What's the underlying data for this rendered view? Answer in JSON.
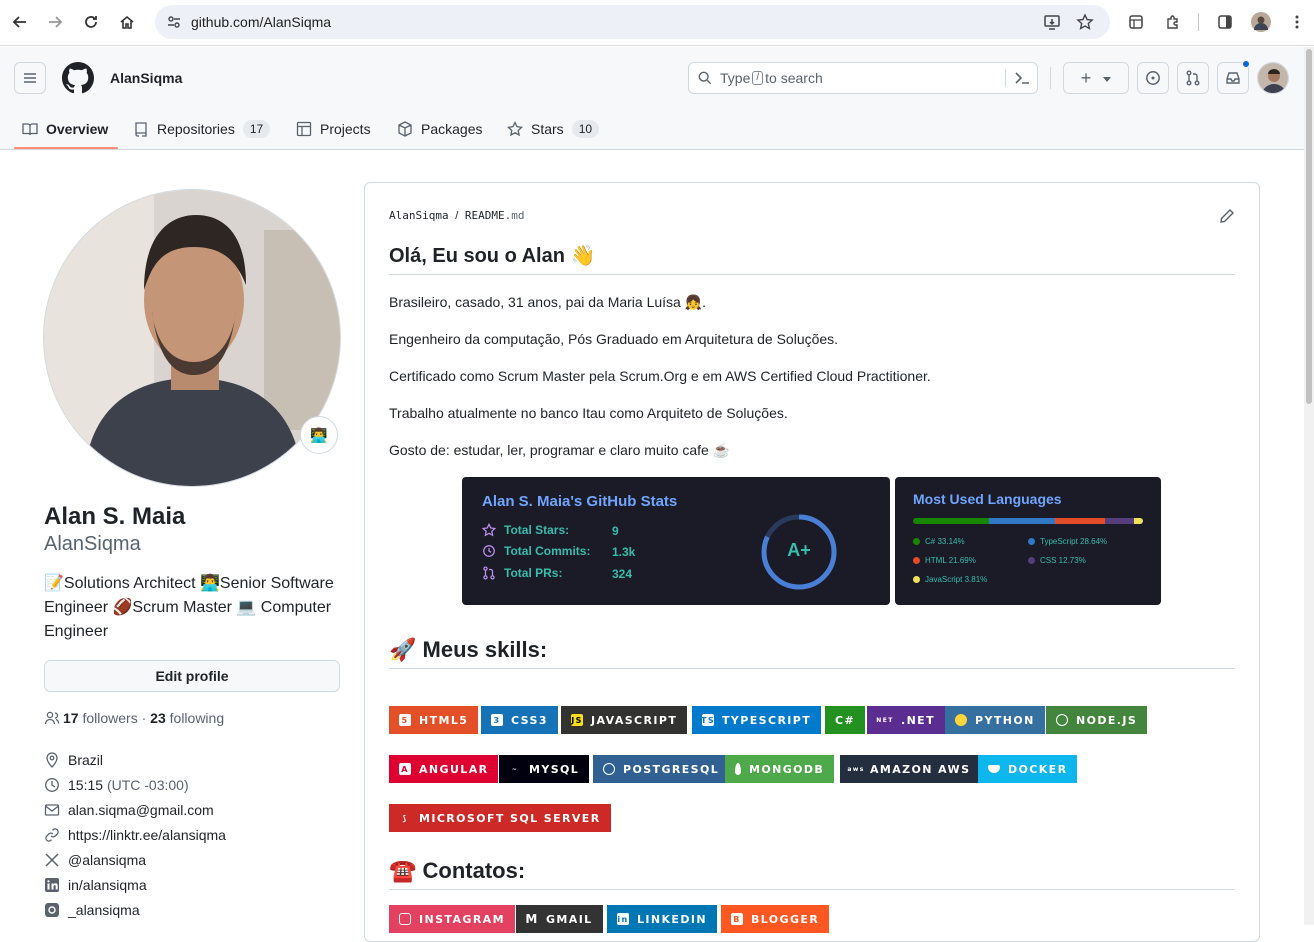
{
  "browser": {
    "url": "github.com/AlanSiqma"
  },
  "header": {
    "username": "AlanSiqma",
    "search_placeholder_pre": "Type",
    "search_key": "/",
    "search_placeholder_post": "to search",
    "create_label": "+"
  },
  "tabs": [
    {
      "label": "Overview",
      "count": ""
    },
    {
      "label": "Repositories",
      "count": "17"
    },
    {
      "label": "Projects",
      "count": ""
    },
    {
      "label": "Packages",
      "count": ""
    },
    {
      "label": "Stars",
      "count": "10"
    }
  ],
  "profile": {
    "name": "Alan S. Maia",
    "login": "AlanSiqma",
    "status_emoji": "👨‍💻",
    "bio": "📝Solutions Architect 👨‍💻Senior Software Engineer 🏈Scrum Master 💻 Computer Engineer",
    "edit_label": "Edit profile",
    "followers_count": "17",
    "followers_label": "followers",
    "sep": "·",
    "following_count": "23",
    "following_label": "following",
    "location": "Brazil",
    "time": "15:15",
    "timezone": "(UTC -03:00)",
    "email": "alan.siqma@gmail.com",
    "website": "https://linktr.ee/alansiqma",
    "twitter": "@alansiqma",
    "linkedin": "in/alansiqma",
    "instagram": "_alansiqma"
  },
  "readme": {
    "owner": "AlanSiqma",
    "slash": "/",
    "file_base": "README",
    "file_ext": ".md",
    "title": "Olá, Eu sou o Alan 👋",
    "p1": "Brasileiro, casado, 31 anos, pai da Maria Luísa 👧.",
    "p2": "Engenheiro da computação, Pós Graduado em Arquitetura de Soluções.",
    "p3": "Certificado como Scrum Master pela Scrum.Org e em AWS Certified Cloud Practitioner.",
    "p4": "Trabalho atualmente no banco Itau como Arquiteto de Soluções.",
    "p5": "Gosto de: estudar, ler, programar e claro muito cafe ☕",
    "skills_title": "🚀 Meus skills:",
    "contacts_title": "☎️ Contatos:"
  },
  "stats_card": {
    "title": "Alan S. Maia's GitHub Stats",
    "rows": [
      {
        "label": "Total Stars:",
        "value": "9"
      },
      {
        "label": "Total Commits:",
        "value": "1.3k"
      },
      {
        "label": "Total PRs:",
        "value": "324"
      }
    ],
    "grade": "A+",
    "grade_progress": 0.82
  },
  "lang_card": {
    "title": "Most Used Languages",
    "langs": [
      {
        "name": "C# 33.14%",
        "pct": 33.14,
        "color": "#178600"
      },
      {
        "name": "TypeScript 28.64%",
        "pct": 28.64,
        "color": "#3178c6"
      },
      {
        "name": "HTML 21.69%",
        "pct": 21.69,
        "color": "#e34c26"
      },
      {
        "name": "CSS 12.73%",
        "pct": 12.73,
        "color": "#563d7c"
      },
      {
        "name": "JavaScript 3.81%",
        "pct": 3.81,
        "color": "#f1e05a"
      }
    ]
  },
  "skills": [
    {
      "label": "HTML5",
      "color": "#e34f26"
    },
    {
      "label": "CSS3",
      "color": "#1572b6"
    },
    {
      "label": "JAVASCRIPT",
      "color": "#323330"
    },
    {
      "label": "TYPESCRIPT",
      "color": "#007acc"
    },
    {
      "label": "C#",
      "color": "#239120"
    },
    {
      "label": ".NET",
      "color": "#5c2d91"
    },
    {
      "label": "PYTHON",
      "color": "#3670a0"
    },
    {
      "label": "NODE.JS",
      "color": "#43853d"
    },
    {
      "label": "ANGULAR",
      "color": "#dd0031"
    },
    {
      "label": "MYSQL",
      "color": "#00000f"
    },
    {
      "label": "POSTGRESQL",
      "color": "#316192"
    },
    {
      "label": "MONGODB",
      "color": "#4ea94b"
    },
    {
      "label": "AMAZON AWS",
      "color": "#232f3e"
    },
    {
      "label": "DOCKER",
      "color": "#0db7ed"
    },
    {
      "label": "MICROSOFT SQL SERVER",
      "color": "#cc2927"
    }
  ],
  "contacts": [
    {
      "label": "INSTAGRAM",
      "color": "#e4405f"
    },
    {
      "label": "GMAIL",
      "color": "#333333"
    },
    {
      "label": "LINKEDIN",
      "color": "#0077b5"
    },
    {
      "label": "BLOGGER",
      "color": "#ff5722"
    }
  ]
}
